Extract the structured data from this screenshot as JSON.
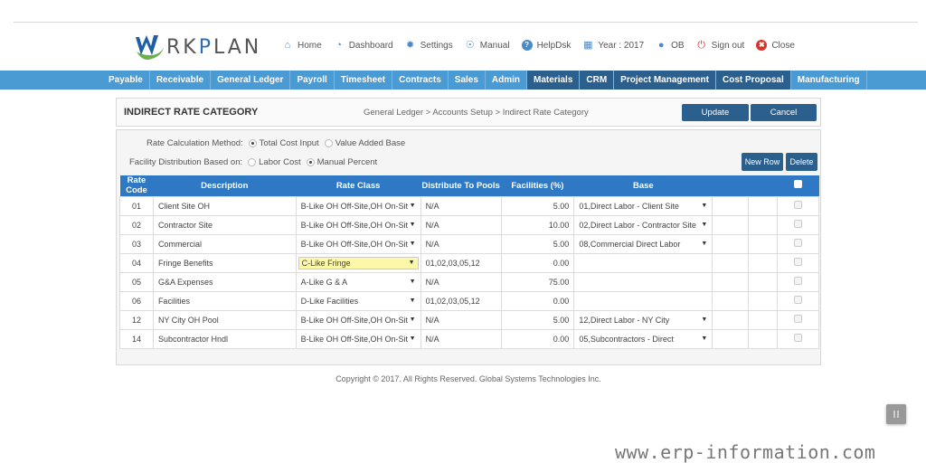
{
  "app": {
    "logo_text_a": "RK",
    "logo_text_p": "P",
    "logo_text_b": "LAN"
  },
  "topnav": [
    {
      "label": "Home",
      "icon": "home-icon",
      "color": "#4a8ac9"
    },
    {
      "label": "Dashboard",
      "icon": "dashboard-icon",
      "color": "#4a8ac9"
    },
    {
      "label": "Settings",
      "icon": "gear-icon",
      "color": "#4a8ac9"
    },
    {
      "label": "Manual",
      "icon": "manual-icon",
      "color": "#4a8ac9"
    },
    {
      "label": "HelpDsk",
      "icon": "help-icon",
      "color": "#4a8ac9"
    },
    {
      "label": "Year : 2017",
      "icon": "calendar-icon",
      "color": "#4a8ac9"
    },
    {
      "label": "OB",
      "icon": "user-icon",
      "color": "#4a8ac9"
    },
    {
      "label": "Sign out",
      "icon": "power-icon",
      "color": "#d9322b"
    },
    {
      "label": "Close",
      "icon": "close-icon",
      "color": "#d9322b"
    }
  ],
  "mainnav": [
    {
      "label": "Payable",
      "active": false
    },
    {
      "label": "Receivable",
      "active": false
    },
    {
      "label": "General Ledger",
      "active": false
    },
    {
      "label": "Payroll",
      "active": false
    },
    {
      "label": "Timesheet",
      "active": false
    },
    {
      "label": "Contracts",
      "active": false
    },
    {
      "label": "Sales",
      "active": false
    },
    {
      "label": "Admin",
      "active": false
    },
    {
      "label": "Materials",
      "active": true
    },
    {
      "label": "CRM",
      "active": true
    },
    {
      "label": "Project Management",
      "active": true
    },
    {
      "label": "Cost Proposal",
      "active": true
    },
    {
      "label": "Manufacturing",
      "active": false
    }
  ],
  "page": {
    "title": "INDIRECT RATE CATEGORY",
    "breadcrumb": "General Ledger > Accounts Setup > Indirect Rate Category",
    "update_label": "Update",
    "cancel_label": "Cancel"
  },
  "options": {
    "rate_calc_label": "Rate Calculation Method:",
    "rate_calc_options": [
      "Total Cost Input",
      "Value Added Base"
    ],
    "rate_calc_selected": "Total Cost Input",
    "facility_label": "Facility Distribution Based on:",
    "facility_options": [
      "Labor Cost",
      "Manual Percent"
    ],
    "facility_selected": "Manual Percent",
    "new_row_label": "New Row",
    "delete_label": "Delete"
  },
  "table": {
    "columns": [
      "Rate Code",
      "Description",
      "Rate Class",
      "Distribute To Pools",
      "Facilities (%)",
      "Base",
      "",
      "",
      ""
    ],
    "rows": [
      {
        "code": "01",
        "description": "Client Site OH",
        "rate_class": "B-Like OH Off-Site,OH On-Sit",
        "pools": "N/A",
        "facilities": "5.00",
        "base": "01,Direct Labor - Client Site",
        "highlight": false
      },
      {
        "code": "02",
        "description": "Contractor Site",
        "rate_class": "B-Like OH Off-Site,OH On-Sit",
        "pools": "N/A",
        "facilities": "10.00",
        "base": "02,Direct Labor - Contractor Site",
        "highlight": false
      },
      {
        "code": "03",
        "description": "Commercial",
        "rate_class": "B-Like OH Off-Site,OH On-Sit",
        "pools": "N/A",
        "facilities": "5.00",
        "base": "08,Commercial Direct Labor",
        "highlight": false
      },
      {
        "code": "04",
        "description": "Fringe Benefits",
        "rate_class": "C-Like Fringe",
        "pools": "01,02,03,05,12",
        "facilities": "0.00",
        "base": "",
        "highlight": true
      },
      {
        "code": "05",
        "description": "G&A Expenses",
        "rate_class": "A-Like G & A",
        "pools": "N/A",
        "facilities": "75.00",
        "base": "",
        "highlight": false
      },
      {
        "code": "06",
        "description": "Facilities",
        "rate_class": "D-Like Facilities",
        "pools": "01,02,03,05,12",
        "facilities": "0.00",
        "base": "",
        "highlight": false
      },
      {
        "code": "12",
        "description": "NY City OH Pool",
        "rate_class": "B-Like OH Off-Site,OH On-Sit",
        "pools": "N/A",
        "facilities": "5.00",
        "base": "12,Direct Labor - NY City",
        "highlight": false
      },
      {
        "code": "14",
        "description": "Subcontractor Hndl",
        "rate_class": "B-Like OH Off-Site,OH On-Sit",
        "pools": "N/A",
        "facilities": "0.00",
        "base": "05,Subcontractors - Direct",
        "highlight": false
      }
    ]
  },
  "footer": {
    "copyright": "Copyright © 2017. All Rights Reserved. Global Systems Technologies Inc."
  },
  "watermark": "www.erp-information.com"
}
